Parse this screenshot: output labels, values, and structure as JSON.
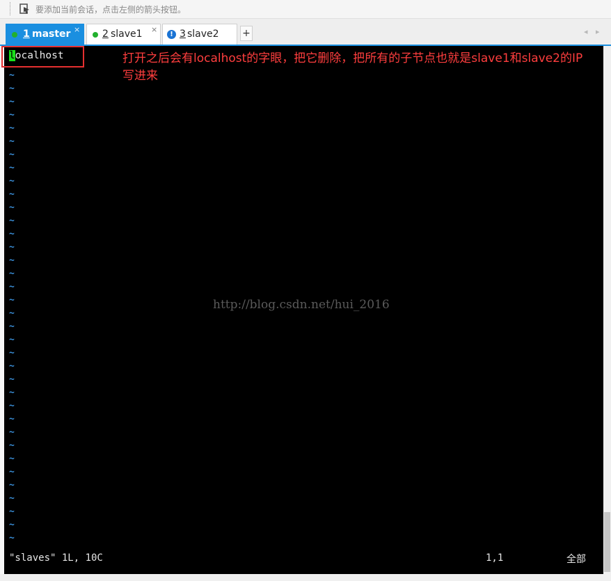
{
  "hint_bar": {
    "icon": "send-arrow-icon",
    "text": "要添加当前会话，点击左侧的箭头按钮。"
  },
  "tabs": [
    {
      "number": "1",
      "label": "master",
      "status": "connected",
      "active": true,
      "close": "×"
    },
    {
      "number": "2",
      "label": "slave1",
      "status": "connected",
      "active": false,
      "close": "×"
    },
    {
      "number": "3",
      "label": "slave2",
      "status": "warning",
      "active": false,
      "warning_glyph": "!"
    }
  ],
  "new_tab_label": "+",
  "tab_nav": "◂ ▸",
  "editor": {
    "cursor_char": "l",
    "line1_rest": "ocalhost",
    "tilde": "~",
    "status_file": "\"slaves\" 1L, 10C",
    "status_position": "1,1",
    "status_all": "全部"
  },
  "annotation": "打开之后会有localhost的字眼，把它删除，把所有的子节点也就是slave1和slave2的IP写进来",
  "watermark": "http://blog.csdn.net/hui_2016",
  "colors": {
    "tab_active": "#1a8fe0",
    "status_connected": "#22b02e",
    "status_warning": "#1a73d4",
    "cursor": "#1ae01a",
    "tilde": "#3a8fd8",
    "annotation": "#ff3e3e",
    "terminal_bg": "#000000"
  }
}
